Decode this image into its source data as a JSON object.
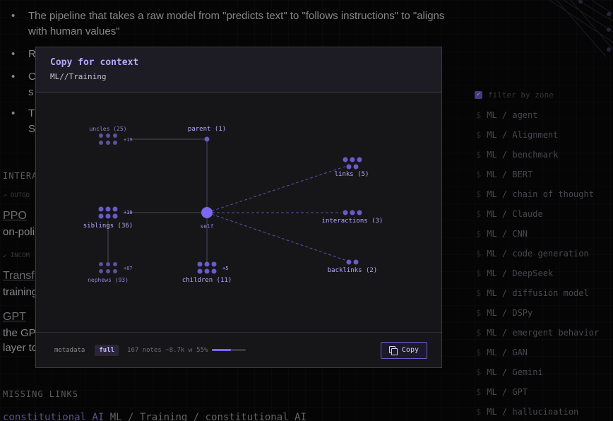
{
  "page": {
    "bullets": [
      "The pipeline that takes a raw model from \"predicts text\" to \"follows instructions\" to \"aligns with human values\""
    ],
    "bullet_fragments": [
      "R",
      "C",
      "s",
      "T",
      "S"
    ],
    "interactions_heading": "INTERA",
    "outgoing_label": "↗ OUTGO",
    "incoming_label": "↙ INCOM",
    "links": [
      {
        "title": "PPO",
        "desc": "on-poli"
      },
      {
        "title": "Transf",
        "desc": "training"
      },
      {
        "title": "GPT",
        "desc": "the GP"
      },
      {
        "desc2": "layer to"
      }
    ],
    "missing_heading": "MISSING LINKS",
    "missing_link_text": "constitutional AI",
    "missing_path": "ML / Training / constitutional AI"
  },
  "sidebar": {
    "filter_label": "filter by zone",
    "zones": [
      "ML / agent",
      "ML / Alignment",
      "ML / benchmark",
      "ML / BERT",
      "ML / chain of thought",
      "ML / Claude",
      "ML / CNN",
      "ML / code generation",
      "ML / DeepSeek",
      "ML / diffusion model",
      "ML / DSPy",
      "ML / emergent behavior",
      "ML / GAN",
      "ML / Gemini",
      "ML / GPT",
      "ML / hallucination"
    ]
  },
  "modal": {
    "title": "Copy for context",
    "subtitle": "ML//Training",
    "graph": {
      "self": "self",
      "parent": "parent (1)",
      "uncles": "uncles (25)",
      "uncles_more": "+19",
      "siblings": "siblings (36)",
      "siblings_more": "+30",
      "nephews": "nephews (93)",
      "nephews_more": "+87",
      "children": "children (11)",
      "children_more": "+5",
      "links": "links (5)",
      "interactions": "interactions (3)",
      "backlinks": "backlinks (2)"
    },
    "footer": {
      "metadata_label": "metadata",
      "mode": "full",
      "stats": "167 notes ~8.7k w",
      "percent": "55%",
      "fill": 0.55,
      "copy_label": "Copy"
    }
  },
  "colors": {
    "accent": "#7b68ee",
    "node": "#6a5acd",
    "label": "#b7a9ff"
  }
}
